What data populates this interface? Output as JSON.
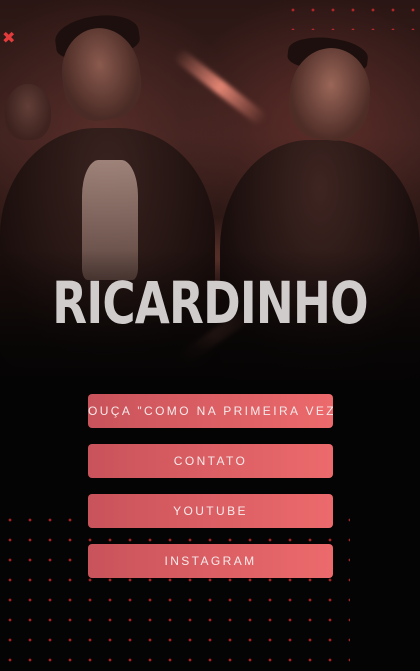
{
  "hero": {
    "close_icon": "close-x-icon",
    "close_glyph": "✖"
  },
  "profile": {
    "name": "RICARDINHO"
  },
  "links": [
    {
      "label": "OUÇA \"COMO NA PRIMEIRA VEZ\""
    },
    {
      "label": "CONTATO"
    },
    {
      "label": "YOUTUBE"
    },
    {
      "label": "INSTAGRAM"
    }
  ],
  "colors": {
    "background": "#050404",
    "button_gradient_start": "#c9535b",
    "button_gradient_end": "#ec6a6c",
    "button_text": "#f6eaea",
    "title": "#d0cccc",
    "dots": "#c0282a"
  }
}
